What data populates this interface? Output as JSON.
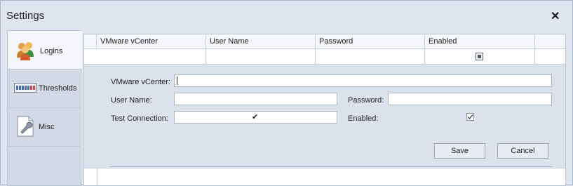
{
  "window": {
    "title": "Settings"
  },
  "nav": {
    "items": [
      {
        "label": "Logins",
        "icon": "users-icon",
        "selected": true
      },
      {
        "label": "Thresholds",
        "icon": "gauge-icon",
        "selected": false
      },
      {
        "label": "Misc",
        "icon": "wrench-icon",
        "selected": false
      }
    ]
  },
  "grid": {
    "columns": [
      "VMware vCenter",
      "User Name",
      "Password",
      "Enabled"
    ],
    "filter_row": {
      "enabled_checked": true
    },
    "detail": {
      "vcenter_label": "VMware vCenter:",
      "vcenter_value": "",
      "username_label": "User Name:",
      "username_value": "",
      "password_label": "Password:",
      "password_value": "",
      "test_label": "Test Connection:",
      "test_glyph": "✔",
      "enabled_label": "Enabled:",
      "enabled_checked": true,
      "save_label": "Save",
      "cancel_label": "Cancel"
    }
  }
}
